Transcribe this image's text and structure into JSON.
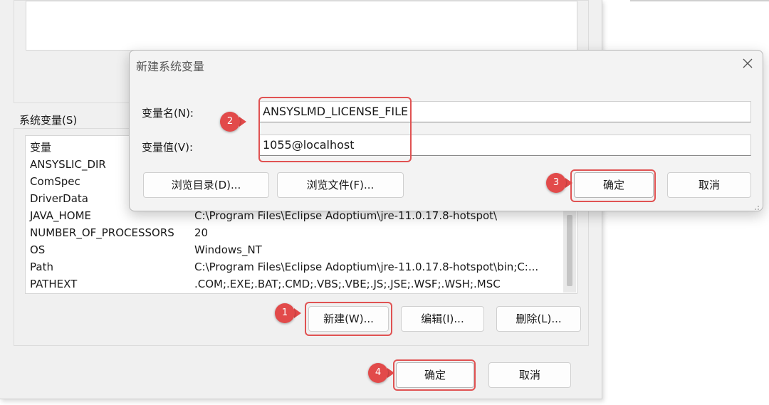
{
  "env_dialog": {
    "section_label": "系统变量(S)",
    "table": {
      "header": [
        "变量"
      ],
      "rows": [
        {
          "name": "ANSYSLIC_DIR",
          "value": ""
        },
        {
          "name": "ComSpec",
          "value": ""
        },
        {
          "name": "DriverData",
          "value": ""
        },
        {
          "name": "JAVA_HOME",
          "value": "C:\\Program Files\\Eclipse Adoptium\\jre-11.0.17.8-hotspot\\"
        },
        {
          "name": "NUMBER_OF_PROCESSORS",
          "value": "20"
        },
        {
          "name": "OS",
          "value": "Windows_NT"
        },
        {
          "name": "Path",
          "value": "C:\\Program Files\\Eclipse Adoptium\\jre-11.0.17.8-hotspot\\bin;C:..."
        },
        {
          "name": "PATHEXT",
          "value": ".COM;.EXE;.BAT;.CMD;.VBS;.VBE;.JS;.JSE;.WSF;.WSH;.MSC"
        }
      ]
    },
    "buttons": {
      "new": "新建(W)...",
      "edit": "编辑(I)...",
      "delete": "删除(L)..."
    },
    "ok": "确定",
    "cancel": "取消"
  },
  "new_var_dialog": {
    "title": "新建系统变量",
    "close_icon": "close-icon",
    "name_label": "变量名(N):",
    "name_value": "ANSYSLMD_LICENSE_FILE",
    "value_label": "变量值(V):",
    "value_value": "1055@localhost",
    "browse_dir": "浏览目录(D)...",
    "browse_file": "浏览文件(F)...",
    "ok": "确定",
    "cancel": "取消"
  },
  "annotations": {
    "steps": [
      "1",
      "2",
      "3",
      "4"
    ],
    "highlight_color": "#e05252",
    "badge_color": "#e24a4a"
  }
}
